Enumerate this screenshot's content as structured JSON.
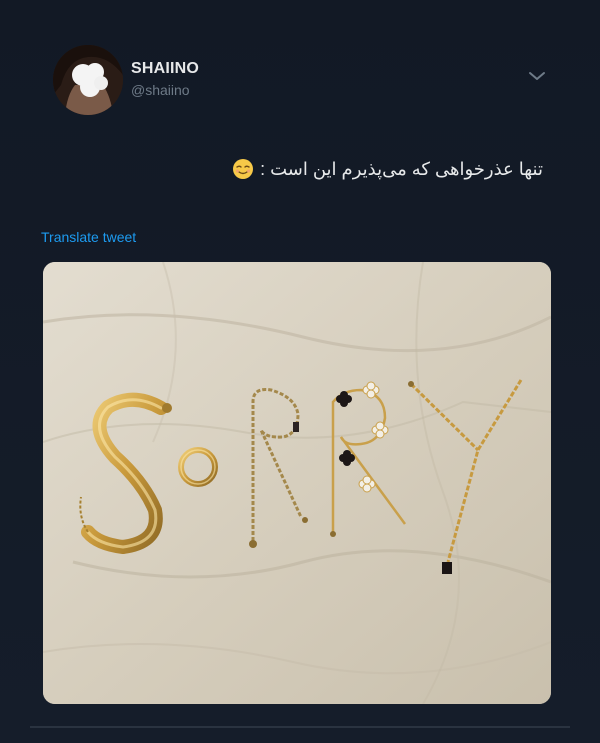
{
  "tweet": {
    "display_name": "SHAIINO",
    "handle": "@shaiino",
    "text": "تنها عذرخواهی که می‌پذیرم این است :",
    "emoji": "relieved-face-emoji",
    "translate_label": "Translate tweet",
    "media": {
      "description_icon": "photo-jewelry-sorry"
    }
  },
  "colors": {
    "background": "#141b26",
    "text_primary": "#e7e9ea",
    "text_secondary": "#6e7b88",
    "link": "#1d9bf0"
  }
}
